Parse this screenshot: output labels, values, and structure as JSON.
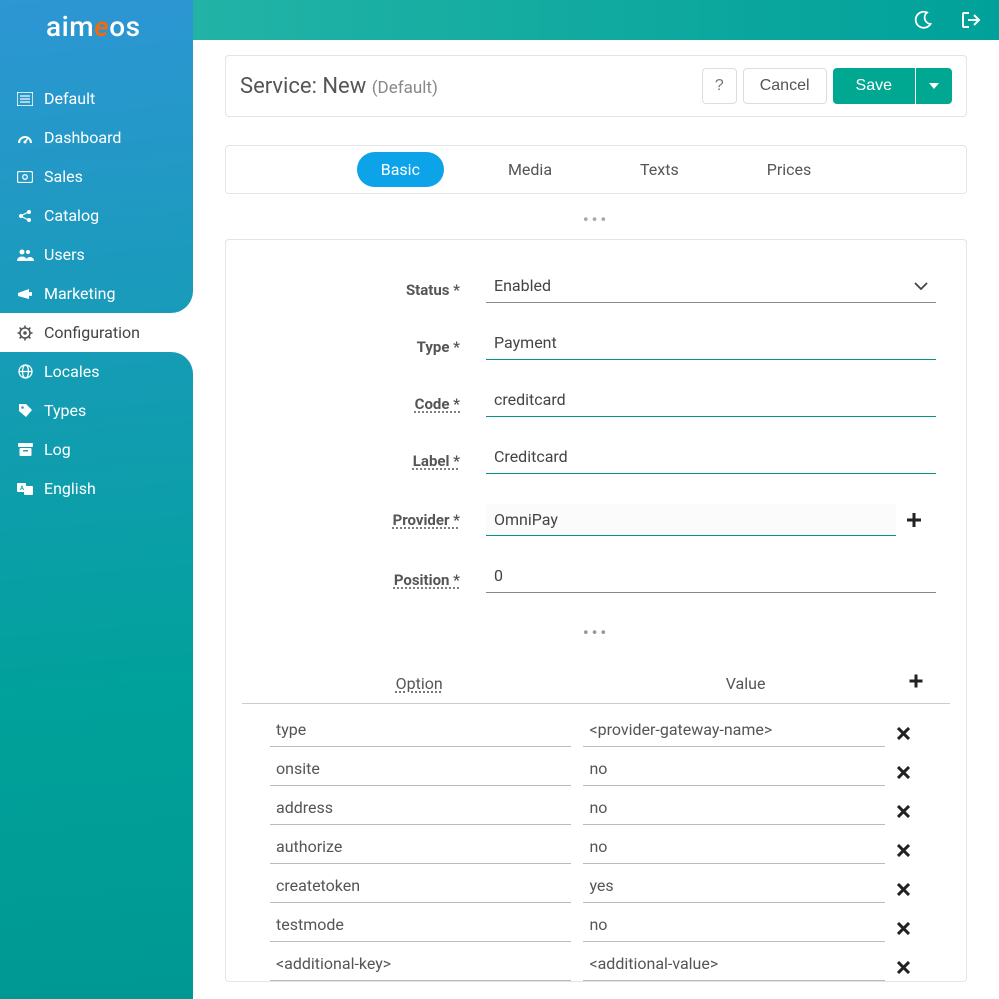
{
  "brand": {
    "a": "aim",
    "e": "e",
    "os": "os"
  },
  "sidebar": {
    "items": [
      {
        "label": "Default"
      },
      {
        "label": "Dashboard"
      },
      {
        "label": "Sales"
      },
      {
        "label": "Catalog"
      },
      {
        "label": "Users"
      },
      {
        "label": "Marketing"
      },
      {
        "label": "Configuration"
      },
      {
        "label": "Locales"
      },
      {
        "label": "Types"
      },
      {
        "label": "Log"
      },
      {
        "label": "English"
      }
    ]
  },
  "header": {
    "title_prefix": "Service: ",
    "title_main": "New",
    "title_sub": "(Default)",
    "help": "?",
    "cancel": "Cancel",
    "save": "Save"
  },
  "tabs": [
    "Basic",
    "Media",
    "Texts",
    "Prices"
  ],
  "form": {
    "status_label": "Status *",
    "status_value": "Enabled",
    "type_label": "Type *",
    "type_value": "Payment",
    "code_label": "Code *",
    "code_value": "creditcard",
    "label_label": "Label *",
    "label_value": "Creditcard",
    "provider_label": "Provider *",
    "provider_value": "OmniPay",
    "position_label": "Position *",
    "position_value": "0"
  },
  "opts": {
    "head_option": "Option",
    "head_value": "Value",
    "rows": [
      {
        "option": "type",
        "value": "<provider-gateway-name>"
      },
      {
        "option": "onsite",
        "value": "no"
      },
      {
        "option": "address",
        "value": "no"
      },
      {
        "option": "authorize",
        "value": "no"
      },
      {
        "option": "createtoken",
        "value": "yes"
      },
      {
        "option": "testmode",
        "value": "no"
      },
      {
        "option": "<additional-key>",
        "value": "<additional-value>"
      }
    ]
  }
}
